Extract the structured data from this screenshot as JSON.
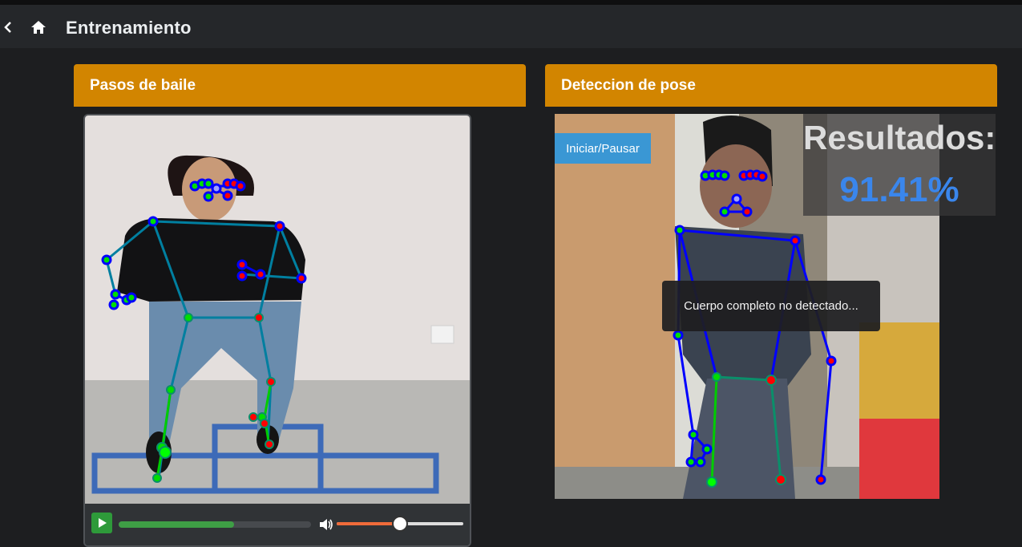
{
  "header": {
    "title": "Entrenamiento",
    "back_icon": "chevron-left-icon",
    "home_icon": "home-icon"
  },
  "left_card": {
    "title": "Pasos de baile",
    "video": {
      "progress_fraction": 0.6,
      "volume_fraction": 0.5
    }
  },
  "right_card": {
    "title": "Deteccion de pose",
    "start_button": "Iniciar/Pausar",
    "results_label": "Resultados:",
    "results_value": "91.41%",
    "toast": "Cuerpo completo no detectado..."
  },
  "colors": {
    "accent": "#d28500",
    "button_blue": "#3a97d4",
    "result_blue": "#3a86ec",
    "skeleton_green": "#00e600",
    "skeleton_red": "#e60000",
    "skeleton_blue": "#0000ff"
  }
}
